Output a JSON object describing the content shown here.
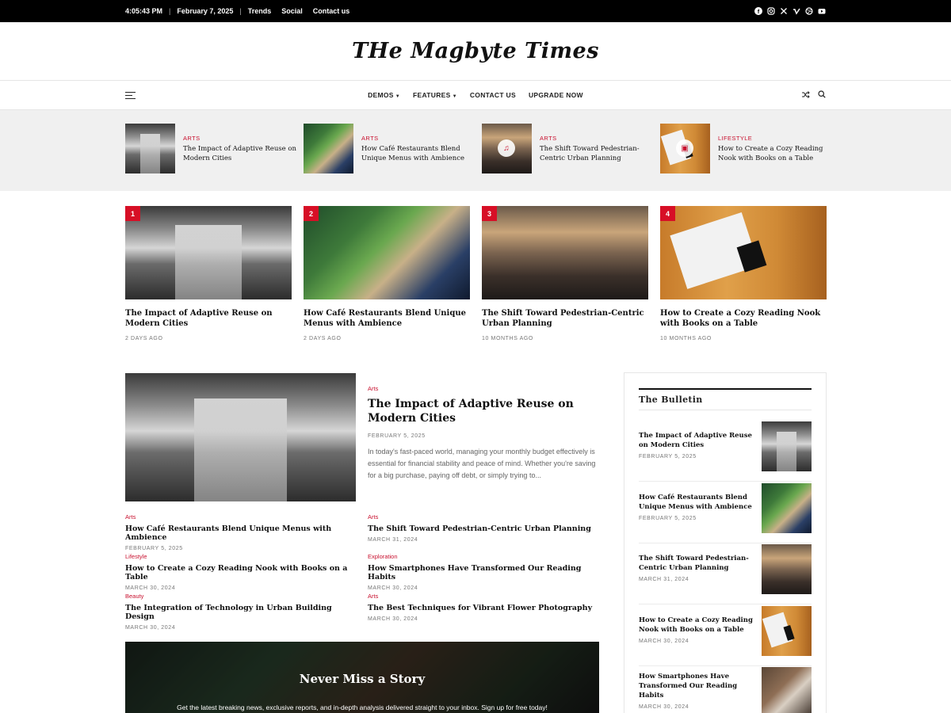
{
  "topbar": {
    "time": "4:05:43 PM",
    "date": "February 7, 2025",
    "links": [
      "Trends",
      "Social",
      "Contact us"
    ],
    "social_icons": [
      "facebook-icon",
      "instagram-icon",
      "x-icon",
      "vimeo-icon",
      "dribbble-icon",
      "youtube-icon"
    ]
  },
  "site": {
    "title": "THe Magbyte Times"
  },
  "nav": {
    "items": [
      {
        "label": "DEMOS",
        "dropdown": true
      },
      {
        "label": "FEATURES",
        "dropdown": true
      },
      {
        "label": "CONTACT US",
        "dropdown": false
      },
      {
        "label": "UPGRADE NOW",
        "dropdown": false
      }
    ]
  },
  "strip": [
    {
      "category": "ARTS",
      "title": "The Impact of Adaptive Reuse on Modern Cities"
    },
    {
      "category": "ARTS",
      "title": "How Café Restaurants Blend Unique Menus with Ambience"
    },
    {
      "category": "ARTS",
      "title": "The Shift Toward Pedestrian-Centric Urban Planning"
    },
    {
      "category": "LIFESTYLE",
      "title": "How to Create a Cozy Reading Nook with Books on a Table"
    }
  ],
  "trending": [
    {
      "rank": "1",
      "title": "The Impact of Adaptive Reuse on Modern Cities",
      "date": "2 DAYS AGO"
    },
    {
      "rank": "2",
      "title": "How Café Restaurants Blend Unique Menus with Ambience",
      "date": "2 DAYS AGO"
    },
    {
      "rank": "3",
      "title": "The Shift Toward Pedestrian-Centric Urban Planning",
      "date": "10 MONTHS AGO"
    },
    {
      "rank": "4",
      "title": "How to Create a Cozy Reading Nook with Books on a Table",
      "date": "10 MONTHS AGO"
    }
  ],
  "featured": {
    "category": "Arts",
    "title": "The Impact of Adaptive Reuse on Modern Cities",
    "date": "FEBRUARY 5, 2025",
    "excerpt": "In today's fast-paced world, managing your monthly budget effectively is essential for financial stability and peace of mind. Whether you're saving for a big purchase, paying off debt, or simply trying to..."
  },
  "posts": [
    {
      "category": "Arts",
      "title": "How Café Restaurants Blend Unique Menus with Ambience",
      "date": "FEBRUARY 5, 2025"
    },
    {
      "category": "Arts",
      "title": "The Shift Toward Pedestrian-Centric Urban Planning",
      "date": "MARCH 31, 2024"
    },
    {
      "category": "Lifestyle",
      "title": "How to Create a Cozy Reading Nook with Books on a Table",
      "date": "MARCH 30, 2024"
    },
    {
      "category": "Exploration",
      "title": "How Smartphones Have Transformed Our Reading Habits",
      "date": "MARCH 30, 2024"
    },
    {
      "category": "Beauty",
      "title": "The Integration of Technology in Urban Building Design",
      "date": "MARCH 30, 2024"
    },
    {
      "category": "Arts",
      "title": "The Best Techniques for Vibrant Flower Photography",
      "date": "MARCH 30, 2024"
    }
  ],
  "newsletter": {
    "heading": "Never Miss a Story",
    "text": "Get the latest breaking news, exclusive reports, and in-depth analysis delivered straight to your inbox. Sign up for free today!"
  },
  "sidebar": {
    "heading": "The Bulletin",
    "items": [
      {
        "title": "The Impact of Adaptive Reuse on Modern Cities",
        "date": "FEBRUARY 5, 2025"
      },
      {
        "title": "How Café Restaurants Blend Unique Menus with Ambience",
        "date": "FEBRUARY 5, 2025"
      },
      {
        "title": "The Shift Toward Pedestrian-Centric Urban Planning",
        "date": "MARCH 31, 2024"
      },
      {
        "title": "How to Create a Cozy Reading Nook with Books on a Table",
        "date": "MARCH 30, 2024"
      },
      {
        "title": "How Smartphones Have Transformed Our Reading Habits",
        "date": "MARCH 30, 2024"
      }
    ]
  },
  "colors": {
    "accent": "#d70f26",
    "topbar_bg": "#000000",
    "strip_bg": "#f0f0f0"
  }
}
